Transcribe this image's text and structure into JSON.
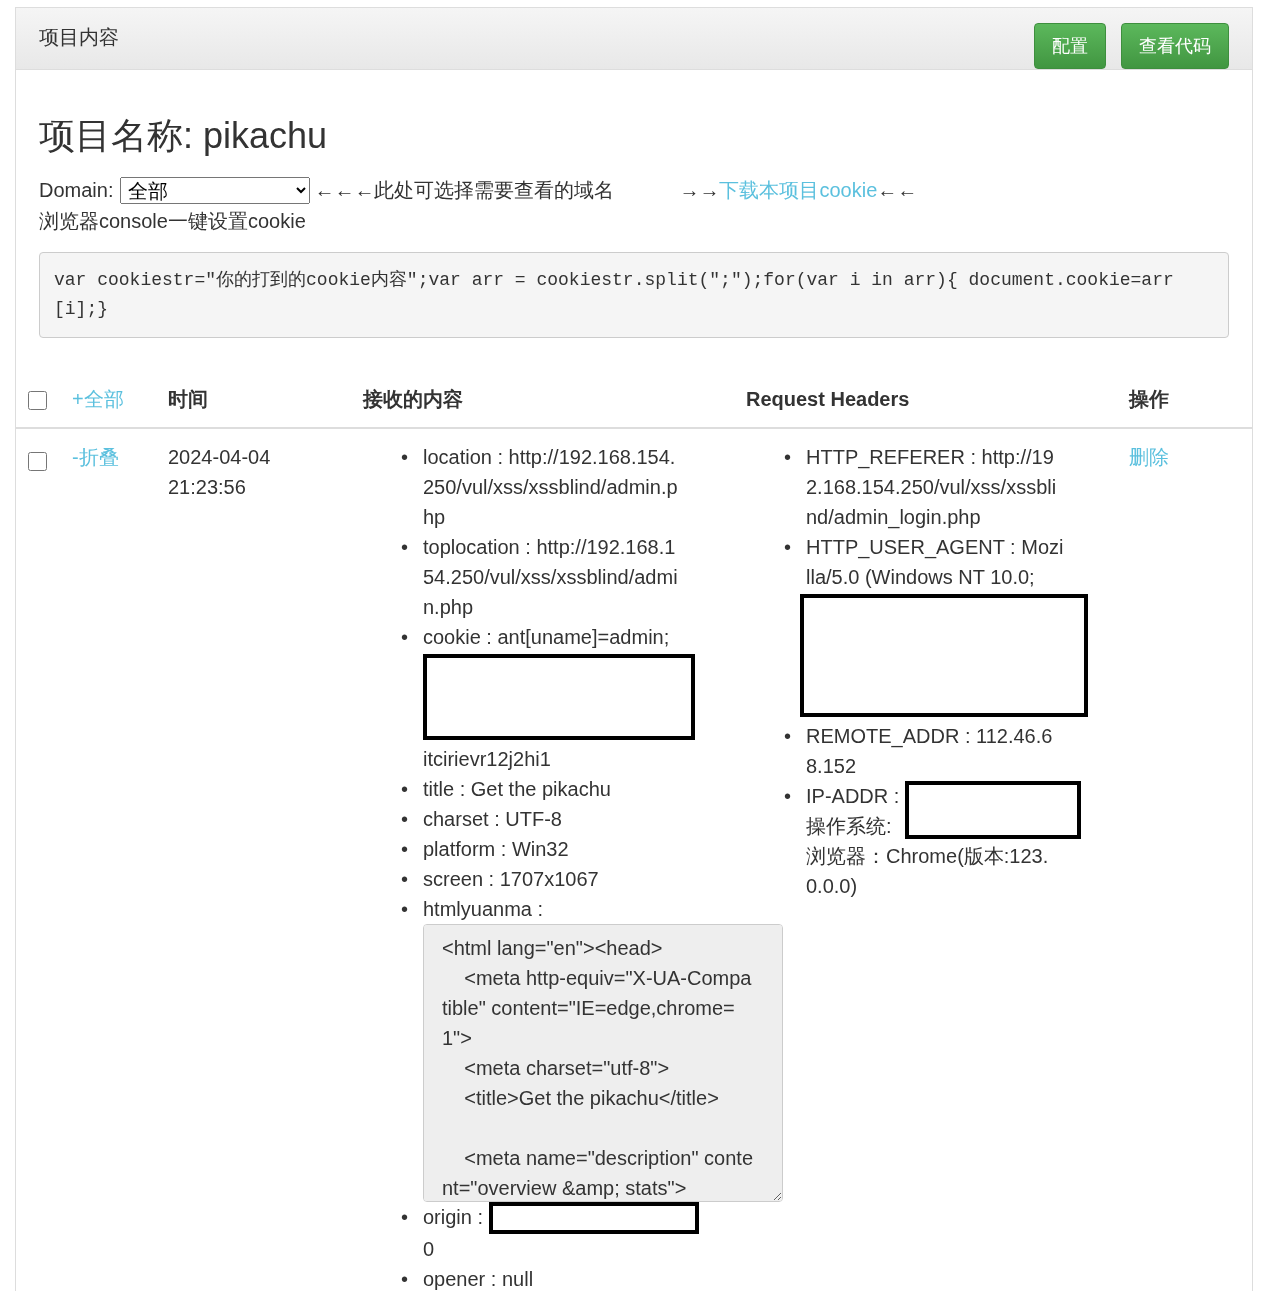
{
  "panel": {
    "title": "项目内容",
    "buttons": [
      "配置",
      "查看代码"
    ]
  },
  "project_title": "项目名称: pikachu",
  "domain": {
    "label": "Domain:",
    "value": "全部",
    "hint": "←←←此处可选择需要查看的域名",
    "arrows_before": "→→",
    "download_link": "下载本项目cookie",
    "arrows_after": "←←"
  },
  "console_label": "浏览器console一键设置cookie",
  "code": "var cookiestr=\"你的打到的cookie内容\";var arr = cookiestr.split(\";\");for(var i in arr){ document.cookie=arr[i];}",
  "table": {
    "select_all": {
      "checked": false
    },
    "toggle_all": "+全部",
    "columns": [
      "时间",
      "接收的内容",
      "Request Headers",
      "操作"
    ],
    "rows": [
      {
        "checked": false,
        "toggle": "-折叠",
        "time": "2024-04-04 21:23:56",
        "content": [
          {
            "marker": "•",
            "parts": [
              {
                "kind": "text",
                "text": "location : http://192.168.154.250/vul/xss/xssblind/admin.php"
              }
            ]
          },
          {
            "marker": "•",
            "parts": [
              {
                "kind": "text",
                "text": "toplocation : http://192.168.154.250/vul/xss/xssblind/admin.php"
              }
            ]
          },
          {
            "marker": "•",
            "parts": [
              {
                "kind": "text",
                "text": "cookie : ant[uname]=admin;"
              },
              {
                "kind": "redacted-block"
              },
              {
                "kind": "text",
                "text": "itcirievr12j2hi1"
              }
            ]
          },
          {
            "marker": "•",
            "parts": [
              {
                "kind": "text",
                "text": "title : Get the pikachu"
              }
            ]
          },
          {
            "marker": "•",
            "parts": [
              {
                "kind": "text",
                "text": "charset : UTF-8"
              }
            ]
          },
          {
            "marker": "•",
            "parts": [
              {
                "kind": "text",
                "text": "platform : Win32"
              }
            ]
          },
          {
            "marker": "•",
            "parts": [
              {
                "kind": "text",
                "text": "screen : 1707x1067"
              }
            ]
          },
          {
            "marker": "•",
            "parts": [
              {
                "kind": "text",
                "text": "htmlyuanma : "
              },
              {
                "kind": "source",
                "text": "<html lang=\"en\"><head>\n    <meta http-equiv=\"X-UA-Compatible\" content=\"IE=edge,chrome=1\">\n    <meta charset=\"utf-8\">\n    <title>Get the pikachu</title>\n\n    <meta name=\"description\" content=\"overview &amp; stats\">"
              }
            ]
          },
          {
            "marker": "•",
            "parts": [
              {
                "kind": "text",
                "text": "origin : "
              },
              {
                "kind": "redacted-inline"
              },
              {
                "kind": "text",
                "text": "0"
              }
            ]
          },
          {
            "marker": "•",
            "parts": [
              {
                "kind": "text",
                "text": "opener : null"
              }
            ]
          }
        ],
        "headers": [
          {
            "marker": "•",
            "parts": [
              {
                "kind": "text",
                "text": "HTTP_REFERER : http://192.168.154.250/vul/xss/xssblind/admin_login.php"
              }
            ]
          },
          {
            "marker": "•",
            "parts": [
              {
                "kind": "text",
                "text": "HTTP_USER_AGENT : Mozilla/5.0 (Windows NT 10.0;"
              },
              {
                "kind": "redacted-block"
              }
            ]
          },
          {
            "marker": "•",
            "parts": [
              {
                "kind": "text",
                "text": "REMOTE_ADDR : 112.46.68.152"
              }
            ]
          },
          {
            "marker": "•",
            "parts": [
              {
                "kind": "text",
                "text": "IP-ADDR : "
              },
              {
                "kind": "redacted-inline"
              },
              {
                "kind": "text",
                "text": "操作系统:\n浏览器：Chrome(版本:123.0.0.0)"
              }
            ]
          }
        ],
        "action": "删除"
      }
    ]
  }
}
